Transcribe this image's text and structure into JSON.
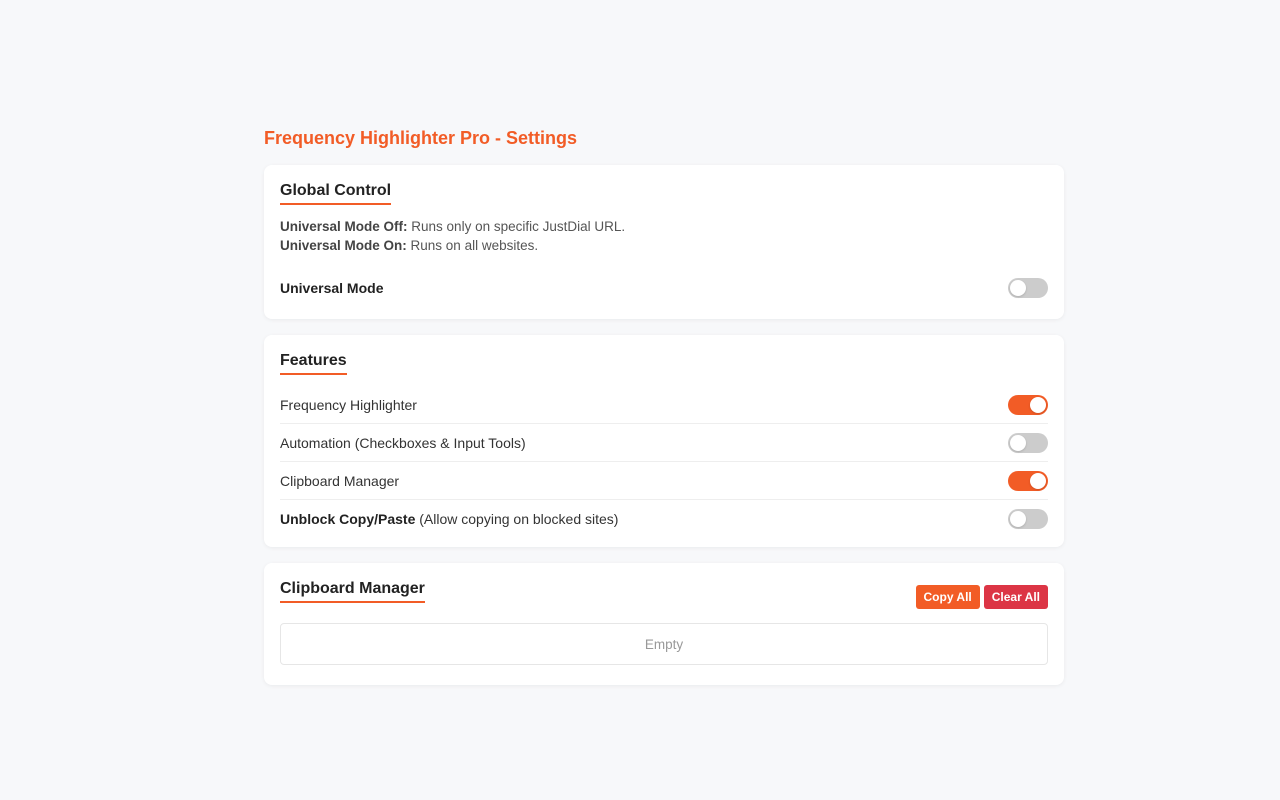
{
  "page": {
    "title": "Frequency Highlighter Pro - Settings"
  },
  "global_control": {
    "title": "Global Control",
    "off_label": "Universal Mode Off:",
    "off_text": " Runs only on specific JustDial URL.",
    "on_label": "Universal Mode On:",
    "on_text": " Runs on all websites.",
    "universal_mode_label": "Universal Mode",
    "universal_mode_enabled": false
  },
  "features": {
    "title": "Features",
    "items": [
      {
        "label": "Frequency Highlighter",
        "enabled": true
      },
      {
        "label": "Automation (Checkboxes & Input Tools)",
        "enabled": false
      },
      {
        "label": "Clipboard Manager",
        "enabled": true
      },
      {
        "label_bold": "Unblock Copy/Paste",
        "label": " (Allow copying on blocked sites)",
        "enabled": false
      }
    ]
  },
  "clipboard_manager": {
    "title": "Clipboard Manager",
    "copy_all_label": "Copy All",
    "clear_all_label": "Clear All",
    "empty_text": "Empty"
  },
  "colors": {
    "accent": "#f25c26",
    "danger": "#dc3545",
    "toggle_off": "#cccccc"
  }
}
